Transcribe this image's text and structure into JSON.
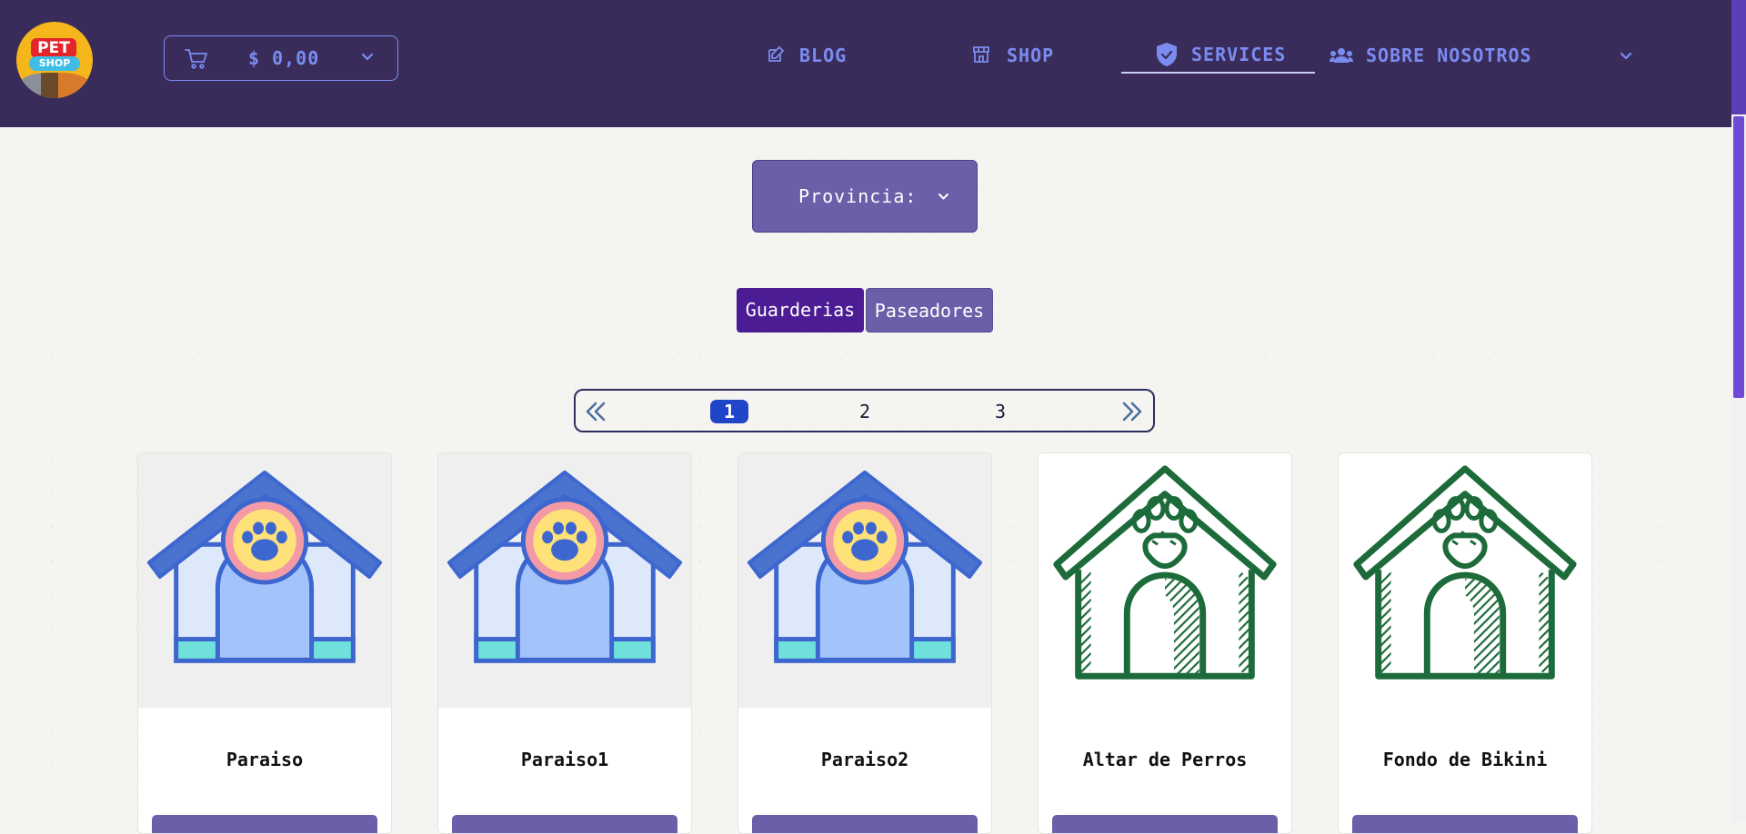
{
  "header": {
    "cart": {
      "amount": "$ 0,00",
      "icon": "cart-icon"
    },
    "nav": [
      {
        "label": "BLOG",
        "icon": "edit-icon"
      },
      {
        "label": "SHOP",
        "icon": "store-icon"
      },
      {
        "label": "SERVICES",
        "icon": "shield-icon",
        "active": true
      },
      {
        "label": "SOBRE NOSOTROS",
        "icon": "users-icon"
      }
    ]
  },
  "filters": {
    "provincia_label": "Provincia:",
    "tabs": [
      {
        "label": "Guarderias",
        "active": true
      },
      {
        "label": "Paseadores",
        "active": false
      }
    ]
  },
  "pagination": {
    "pages": [
      "1",
      "2",
      "3"
    ],
    "current": "1"
  },
  "cards": [
    {
      "name": "Paraiso",
      "image": "colored-doghouse"
    },
    {
      "name": "Paraiso1",
      "image": "colored-doghouse"
    },
    {
      "name": "Paraiso2",
      "image": "colored-doghouse"
    },
    {
      "name": "Altar de Perros",
      "image": "green-sketch-doghouse"
    },
    {
      "name": "Fondo de Bikini",
      "image": "green-sketch-doghouse"
    }
  ],
  "colors": {
    "header_bg": "#3a2c5a",
    "nav_text": "#7a8cf0",
    "tab_active": "#4b1c94",
    "tab_inactive": "#6a5fa8",
    "page_current": "#1f45c8"
  }
}
